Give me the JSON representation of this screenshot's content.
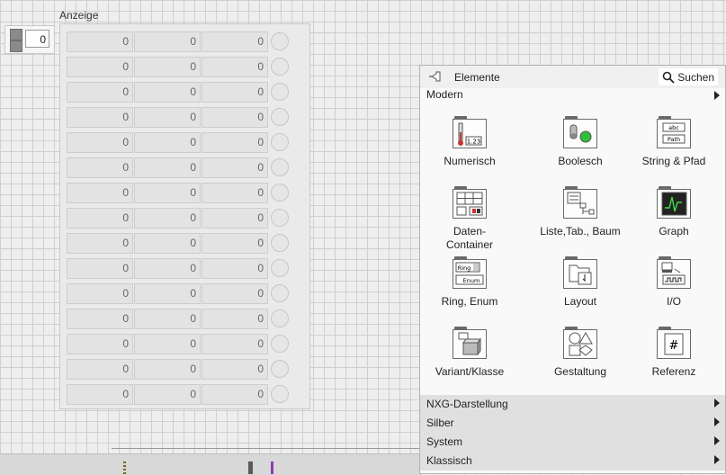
{
  "array": {
    "label": "Anzeige",
    "index_value": "0",
    "rows": [
      [
        "0",
        "0",
        "0"
      ],
      [
        "0",
        "0",
        "0"
      ],
      [
        "0",
        "0",
        "0"
      ],
      [
        "0",
        "0",
        "0"
      ],
      [
        "0",
        "0",
        "0"
      ],
      [
        "0",
        "0",
        "0"
      ],
      [
        "0",
        "0",
        "0"
      ],
      [
        "0",
        "0",
        "0"
      ],
      [
        "0",
        "0",
        "0"
      ],
      [
        "0",
        "0",
        "0"
      ],
      [
        "0",
        "0",
        "0"
      ],
      [
        "0",
        "0",
        "0"
      ],
      [
        "0",
        "0",
        "0"
      ],
      [
        "0",
        "0",
        "0"
      ],
      [
        "0",
        "0",
        "0"
      ]
    ]
  },
  "palette": {
    "title": "Elemente",
    "search_label": "Suchen",
    "category": "Modern",
    "items": [
      {
        "label": "Numerisch",
        "icon": "numeric-icon"
      },
      {
        "label": "Boolesch",
        "icon": "boolean-icon"
      },
      {
        "label": "String & Pfad",
        "icon": "string-path-icon"
      },
      {
        "label": "Daten-\nContainer",
        "icon": "data-container-icon"
      },
      {
        "label": "Liste,Tab., Baum",
        "icon": "list-table-tree-icon"
      },
      {
        "label": "Graph",
        "icon": "graph-icon"
      },
      {
        "label": "Ring, Enum",
        "icon": "ring-enum-icon"
      },
      {
        "label": "Layout",
        "icon": "layout-icon"
      },
      {
        "label": "I/O",
        "icon": "io-icon"
      },
      {
        "label": "Variant/Klasse",
        "icon": "variant-class-icon"
      },
      {
        "label": "Gestaltung",
        "icon": "decorations-icon"
      },
      {
        "label": "Referenz",
        "icon": "refnum-icon"
      }
    ],
    "sections": [
      {
        "label": "NXG-Darstellung"
      },
      {
        "label": "Silber"
      },
      {
        "label": "System"
      },
      {
        "label": "Klassisch"
      }
    ]
  },
  "colors": {
    "canvas": "#eeeeee",
    "grid": "#cfcfcf",
    "led_off": "#e6e6e6",
    "bool_green": "#2fbf3a"
  }
}
